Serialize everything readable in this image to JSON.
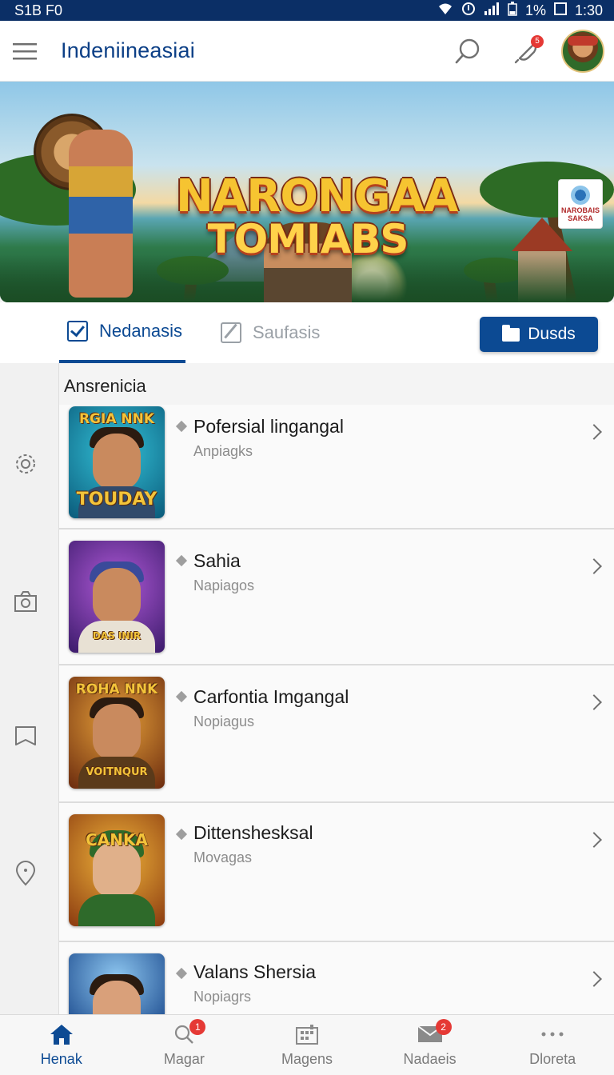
{
  "status_bar": {
    "left_text": "S1B F0",
    "battery_text": "1%",
    "time": "1:30"
  },
  "app_bar": {
    "title": "Indeniineasiai",
    "notification_badge": "5"
  },
  "hero": {
    "title_line1": "NARONGAA",
    "title_line2": "TOMIABS",
    "corner_badge_text": "NAROBAIS\nSAKSA"
  },
  "tabs": {
    "active_label": "Nedanasis",
    "inactive_label": "Saufasis",
    "action_button_label": "Dusds"
  },
  "section": {
    "label": "Ansrenicia"
  },
  "list": [
    {
      "title": "Pofersial lingangal",
      "subtitle": "Anpiagks",
      "cover_caption_top": "RGIA NNK",
      "cover_caption_bottom": "TOUDAY"
    },
    {
      "title": "Sahia",
      "subtitle": "Napiagos",
      "cover_caption_top": "",
      "cover_caption_bottom": "DAS INIR"
    },
    {
      "title": "Carfontia Imgangal",
      "subtitle": "Nopiagus",
      "cover_caption_top": "ROHA NNK",
      "cover_caption_bottom": "VOITNQUR"
    },
    {
      "title": "Dittenshesksal",
      "subtitle": "Movagas",
      "cover_caption_top": "CANKA",
      "cover_caption_bottom": ""
    },
    {
      "title": "Valans Shersia",
      "subtitle": "Nopiagrs",
      "cover_caption_top": "",
      "cover_caption_bottom": ""
    }
  ],
  "bottom_nav": [
    {
      "label": "Henak",
      "icon": "home-icon",
      "active": true,
      "badge": ""
    },
    {
      "label": "Magar",
      "icon": "search-icon",
      "active": false,
      "badge": "1"
    },
    {
      "label": "Magens",
      "icon": "grid-icon",
      "active": false,
      "badge": ""
    },
    {
      "label": "Nadaeis",
      "icon": "mail-icon",
      "active": false,
      "badge": "2"
    },
    {
      "label": "Dloreta",
      "icon": "more-icon",
      "active": false,
      "badge": ""
    }
  ],
  "colors": {
    "primary": "#0c4a93",
    "status_bar": "#0b2f66",
    "badge": "#e53935"
  }
}
